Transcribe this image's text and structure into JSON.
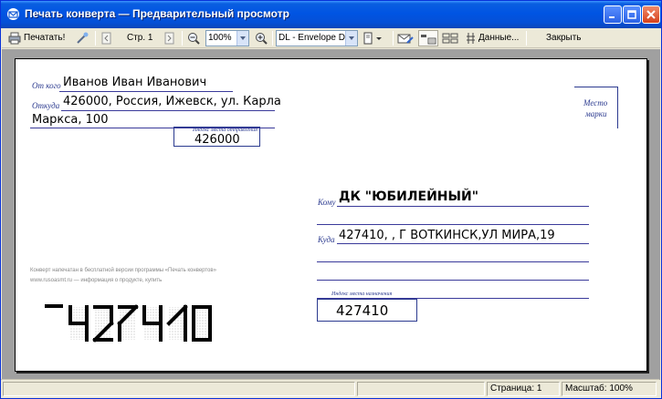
{
  "window": {
    "title": "Печать конверта — Предварительный просмотр"
  },
  "toolbar": {
    "print_label": "Печатать!",
    "page_label": "Стр. 1",
    "zoom_value": "100%",
    "envelope_format": "DL - Envelope DL",
    "data_label": "Данные...",
    "close_label": "Закрыть"
  },
  "envelope": {
    "from_label": "От кого",
    "from_value": "Иванов Иван Иванович",
    "from_addr_label": "Откуда",
    "from_addr_line1": "426000, Россия, Ижевск, ул. Карла",
    "from_addr_line2": "Маркса, 100",
    "from_index_label": "Индекс места отправления",
    "from_index_value": "426000",
    "stamp_label_line1": "Место",
    "stamp_label_line2": "марки",
    "to_label": "Кому",
    "to_value": "ДК \"ЮБИЛЕЙНЫЙ\"",
    "to_addr_label": "Куда",
    "to_addr_value": "427410, , Г ВОТКИНСК,УЛ МИРА,19",
    "to_index_label": "Индекс места назначения",
    "to_index_value": "427410",
    "note_line1": "Конверт напечатан в бесплатной версии программы «Печать конвертов»",
    "note_line2": "www.rusoasmt.ru — информация о продукте, купить",
    "barcode_digits": "427410"
  },
  "status": {
    "page": "Страница: 1",
    "scale": "Масштаб: 100%"
  },
  "colors": {
    "titlebar": "#0054e3",
    "envelope_ink": "#2b3a8f",
    "viewport_bg": "#a0a0a0"
  }
}
